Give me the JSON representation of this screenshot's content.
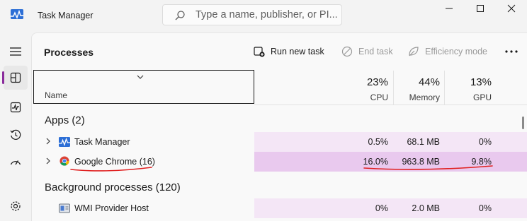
{
  "window": {
    "title": "Task Manager"
  },
  "search": {
    "placeholder": "Type a name, publisher, or PI..."
  },
  "toolbar": {
    "page_title": "Processes",
    "run_new_task": "Run new task",
    "end_task": "End task",
    "efficiency_mode": "Efficiency mode"
  },
  "table": {
    "name_header": "Name",
    "columns": [
      {
        "percent": "23%",
        "label": "CPU"
      },
      {
        "percent": "44%",
        "label": "Memory"
      },
      {
        "percent": "13%",
        "label": "GPU"
      }
    ]
  },
  "groups": {
    "apps": "Apps (2)",
    "background": "Background processes (120)"
  },
  "rows": [
    {
      "name": "Task Manager",
      "cpu": "0.5%",
      "memory": "68.1 MB",
      "gpu": "0%",
      "icon": "task-manager-icon"
    },
    {
      "name": "Google Chrome (16)",
      "cpu": "16.0%",
      "memory": "963.8 MB",
      "gpu": "9.8%",
      "icon": "chrome-icon"
    },
    {
      "name": "WMI Provider Host",
      "cpu": "0%",
      "memory": "2.0 MB",
      "gpu": "0%",
      "icon": "wmi-icon"
    }
  ],
  "colors": {
    "accent": "#8a2b9c",
    "heat_light": "#f4e6f6",
    "heat_selected": "#e9c9ee",
    "annotation": "#e02020"
  },
  "icons": {
    "nav": [
      "hamburger-icon",
      "processes-icon",
      "performance-icon",
      "app-history-icon",
      "startup-apps-icon",
      "settings-icon"
    ]
  }
}
